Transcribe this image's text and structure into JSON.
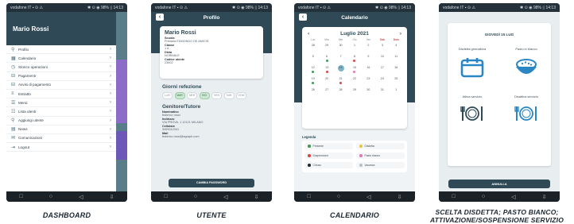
{
  "status": {
    "left": "vodafone IT ▪ ⊙ ⚠",
    "right": "✱ ⊙ ◉ 98% ▯ 14:13"
  },
  "navbar": {
    "back": "◁",
    "home": "○",
    "recent": "□",
    "menu": "⇩"
  },
  "captions": {
    "dashboard": "DASHBOARD",
    "utente": "UTENTE",
    "calendario": "CALENDARIO",
    "scelta_line1": "SCELTA DISDETTA; PASTO BIANCO;",
    "scelta_line2": "ATTIVAZIONE/SOSPENSIONE SERVIZIO"
  },
  "dashboard": {
    "user_name": "Mario Rossi",
    "menu": [
      {
        "label": "Profilo",
        "icon": "user-icon",
        "glyph": "⚲"
      },
      {
        "label": "Calendario",
        "icon": "calendar-icon",
        "glyph": "▦"
      },
      {
        "label": "Storico operazioni",
        "icon": "history-icon",
        "glyph": "◷"
      },
      {
        "label": "Pagamenti",
        "icon": "payments-icon",
        "glyph": "⊟"
      },
      {
        "label": "Avvisi di pagamento",
        "icon": "payment-notices-icon",
        "glyph": "⊟"
      },
      {
        "label": "Estratto",
        "icon": "statement-icon",
        "glyph": "≡"
      },
      {
        "label": "Menù",
        "icon": "menu-icon",
        "glyph": "☰"
      },
      {
        "label": "Lista utenti",
        "icon": "users-list-icon",
        "glyph": "☷"
      },
      {
        "label": "Aggiungi utente",
        "icon": "add-user-icon",
        "glyph": "⚲"
      },
      {
        "label": "News",
        "icon": "news-icon",
        "glyph": "▤"
      },
      {
        "label": "Comunicazioni",
        "icon": "messages-icon",
        "glyph": "✉"
      },
      {
        "label": "Logout",
        "icon": "logout-icon",
        "glyph": "⇥"
      }
    ]
  },
  "profilo": {
    "title": "Profilo",
    "name": "Mario Rossi",
    "fields": [
      {
        "label": "Scuola",
        "value": "Primaria EDMONDO DE AMICIS"
      },
      {
        "label": "Classe",
        "value": "1 A"
      },
      {
        "label": "Dieta",
        "value": "NORMALE"
      },
      {
        "label": "Codice utente",
        "value": "23602"
      }
    ],
    "giorni_title": "Giorni refezione",
    "days": [
      {
        "label": "LUN",
        "on": false
      },
      {
        "label": "MAR",
        "on": true
      },
      {
        "label": "MER",
        "on": false
      },
      {
        "label": "GIO",
        "on": true
      },
      {
        "label": "VEN",
        "on": false
      },
      {
        "label": "SAB",
        "on": false
      },
      {
        "label": "DOM",
        "on": false
      }
    ],
    "genitore_title": "Genitore/Tutore",
    "genitore_fields": [
      {
        "label": "Nominativo",
        "value": "federico rossi"
      },
      {
        "label": "Indirizzo",
        "value": "VIA PROVA, 1 12121 MILANO"
      },
      {
        "label": "Cellulare",
        "value": "3459012341"
      },
      {
        "label": "Mail",
        "value": "federico.rossi@agraph.com"
      }
    ],
    "cambia_password": "CAMBIA PASSWORD"
  },
  "calendario": {
    "title": "Calendario",
    "month": "Luglio 2021",
    "prev": "‹",
    "next": "›",
    "weekdays": [
      "Lun",
      "Mar",
      "Mer",
      "Gio",
      "Ven",
      "Sab",
      "Dom"
    ],
    "days": [
      {
        "n": "28",
        "dot": ""
      },
      {
        "n": "29",
        "dot": ""
      },
      {
        "n": "30",
        "dot": ""
      },
      {
        "n": "1",
        "dot": ""
      },
      {
        "n": "2",
        "dot": ""
      },
      {
        "n": "3",
        "dot": ""
      },
      {
        "n": "4",
        "dot": ""
      },
      {
        "n": "5",
        "dot": ""
      },
      {
        "n": "6",
        "dot": "#3f9b55"
      },
      {
        "n": "7",
        "dot": ""
      },
      {
        "n": "8",
        "dot": "#d94848"
      },
      {
        "n": "9",
        "dot": ""
      },
      {
        "n": "10",
        "dot": ""
      },
      {
        "n": "11",
        "dot": ""
      },
      {
        "n": "12",
        "dot": "#3f9b55"
      },
      {
        "n": "13",
        "dot": "#d94848"
      },
      {
        "n": "14",
        "dot": "",
        "sel": true
      },
      {
        "n": "15",
        "dot": "#e07bb5"
      },
      {
        "n": "16",
        "dot": ""
      },
      {
        "n": "17",
        "dot": ""
      },
      {
        "n": "18",
        "dot": ""
      },
      {
        "n": "19",
        "dot": "#3f9b55"
      },
      {
        "n": "20",
        "dot": ""
      },
      {
        "n": "21",
        "dot": "#d94848"
      },
      {
        "n": "22",
        "dot": ""
      },
      {
        "n": "23",
        "dot": ""
      },
      {
        "n": "24",
        "dot": ""
      },
      {
        "n": "25",
        "dot": ""
      },
      {
        "n": "26",
        "dot": ""
      },
      {
        "n": "27",
        "dot": ""
      },
      {
        "n": "28",
        "dot": ""
      },
      {
        "n": "29",
        "dot": ""
      },
      {
        "n": "30",
        "dot": ""
      },
      {
        "n": "31",
        "dot": ""
      },
      {
        "n": "1",
        "dot": ""
      }
    ],
    "legend_title": "Legenda",
    "legend": [
      {
        "label": "Presente",
        "color": "#3f9b55"
      },
      {
        "label": "Disdetta",
        "color": "#e5c84a"
      },
      {
        "label": "Sospensione",
        "color": "#d94848"
      },
      {
        "label": "Pasto bianco",
        "color": "#e07bb5"
      },
      {
        "label": "Chiuso",
        "color": "#1f2a33"
      },
      {
        "label": "Vacanza",
        "color": "#b8c2c8"
      }
    ]
  },
  "scelta": {
    "date": "GIOVEDÌ 15 LUG",
    "options": [
      {
        "label": "Disdetta giornaliera",
        "icon": "calendar-icon"
      },
      {
        "label": "Pasto in bianco",
        "icon": "rice-bowl-icon"
      },
      {
        "label": "Attiva servizio",
        "icon": "plate-cutlery-icon"
      },
      {
        "label": "Disattiva servizio",
        "icon": "plate-cutlery-icon"
      }
    ],
    "annulla": "ANNULLA"
  },
  "colors": {
    "primary": "#2f4a56",
    "accent": "#2a87c4"
  }
}
